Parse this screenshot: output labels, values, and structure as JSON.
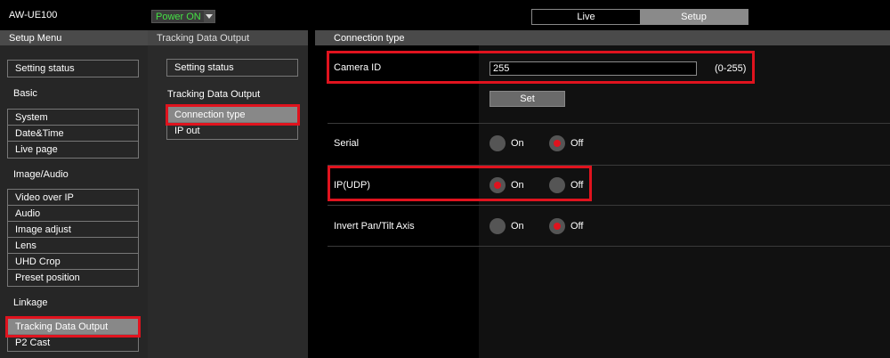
{
  "header": {
    "model": "AW-UE100",
    "power_label": "Power ON",
    "modes": [
      "Live",
      "Setup"
    ]
  },
  "setup_menu": {
    "title": "Setup Menu",
    "setting_status": "Setting status",
    "basic": {
      "title": "Basic",
      "items": [
        "System",
        "Date&Time",
        "Live page"
      ]
    },
    "image_audio": {
      "title": "Image/Audio",
      "items": [
        "Video over IP",
        "Audio",
        "Image adjust",
        "Lens",
        "UHD Crop",
        "Preset position"
      ]
    },
    "linkage": {
      "title": "Linkage",
      "items": [
        "Tracking Data Output",
        "P2 Cast"
      ]
    }
  },
  "submenu": {
    "title": "Tracking Data Output",
    "setting_status": "Setting status",
    "section": "Tracking Data Output",
    "items": [
      "Connection type",
      "IP out"
    ]
  },
  "content": {
    "title": "Connection type",
    "camera_id": {
      "label": "Camera ID",
      "value": "255",
      "range": "(0-255)",
      "set_label": "Set"
    },
    "serial": {
      "label": "Serial",
      "on": "On",
      "off": "Off",
      "selected": "Off"
    },
    "ip_udp": {
      "label": "IP(UDP)",
      "on": "On",
      "off": "Off",
      "selected": "On"
    },
    "invert": {
      "label": "Invert Pan/Tilt Axis",
      "on": "On",
      "off": "Off",
      "selected": "Off"
    }
  },
  "colors": {
    "highlight": "#e0131e",
    "power_text": "#45e045",
    "selected_item": "#888888"
  }
}
